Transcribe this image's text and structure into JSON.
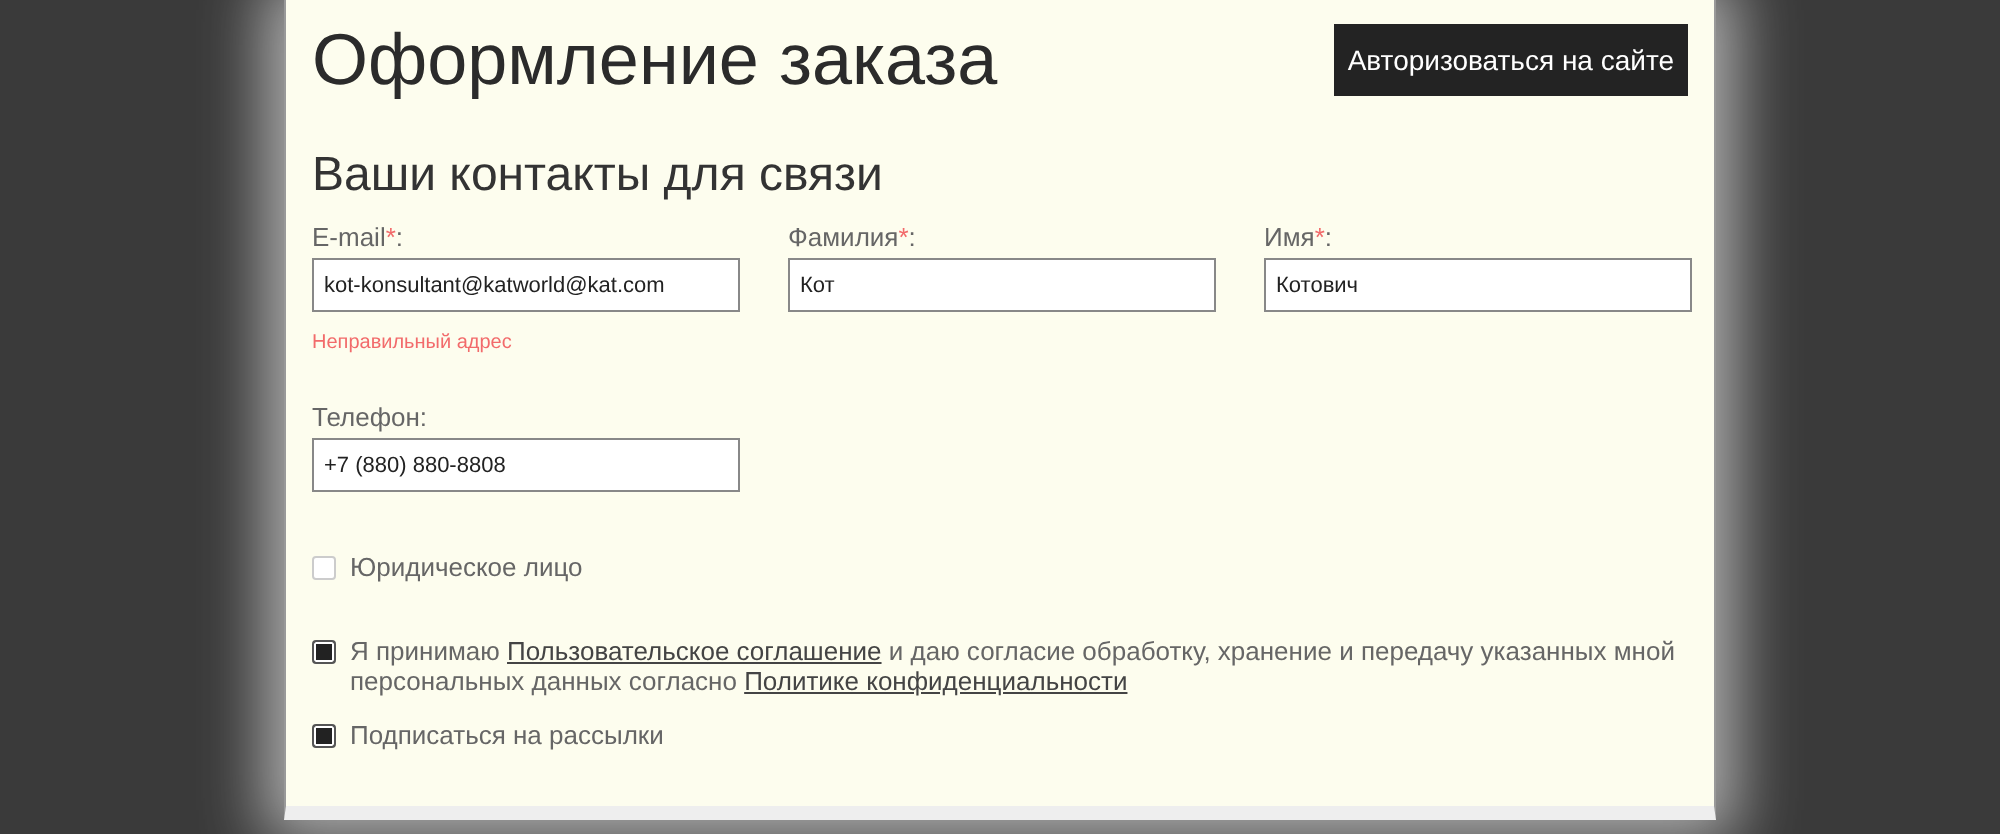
{
  "title": "Оформление заказа",
  "login_button": "Авторизоваться на сайте",
  "section_title": "Ваши контакты для связи",
  "fields": [
    {
      "label": "E-mail",
      "required_mark": "*",
      "label_end": ":",
      "value": "kot-konsultant@katworld@kat.com",
      "error": "Неправильный адрес"
    },
    {
      "label": "Фамилия",
      "required_mark": "*",
      "label_end": ":",
      "value": "Кот"
    },
    {
      "label": "Имя",
      "required_mark": "*",
      "label_end": ":",
      "value": "Котович"
    }
  ],
  "phone": {
    "label": "Телефон:",
    "value": "+7 (880) 880-8808"
  },
  "checkboxes": [
    {
      "checked": false,
      "parts": [
        {
          "kind": "text",
          "text": "Юридическое лицо"
        }
      ]
    },
    {
      "checked": true,
      "parts": [
        {
          "kind": "text",
          "text": "Я принимаю "
        },
        {
          "kind": "link",
          "text": "Пользовательское соглашение"
        },
        {
          "kind": "text",
          "text": " и даю согласие обработку, хранение и передачу указанных мной персональных данных согласно "
        },
        {
          "kind": "link",
          "text": "Политике конфиденциальности"
        }
      ]
    },
    {
      "checked": true,
      "parts": [
        {
          "kind": "text",
          "text": "Подписаться на рассылки"
        }
      ]
    }
  ]
}
